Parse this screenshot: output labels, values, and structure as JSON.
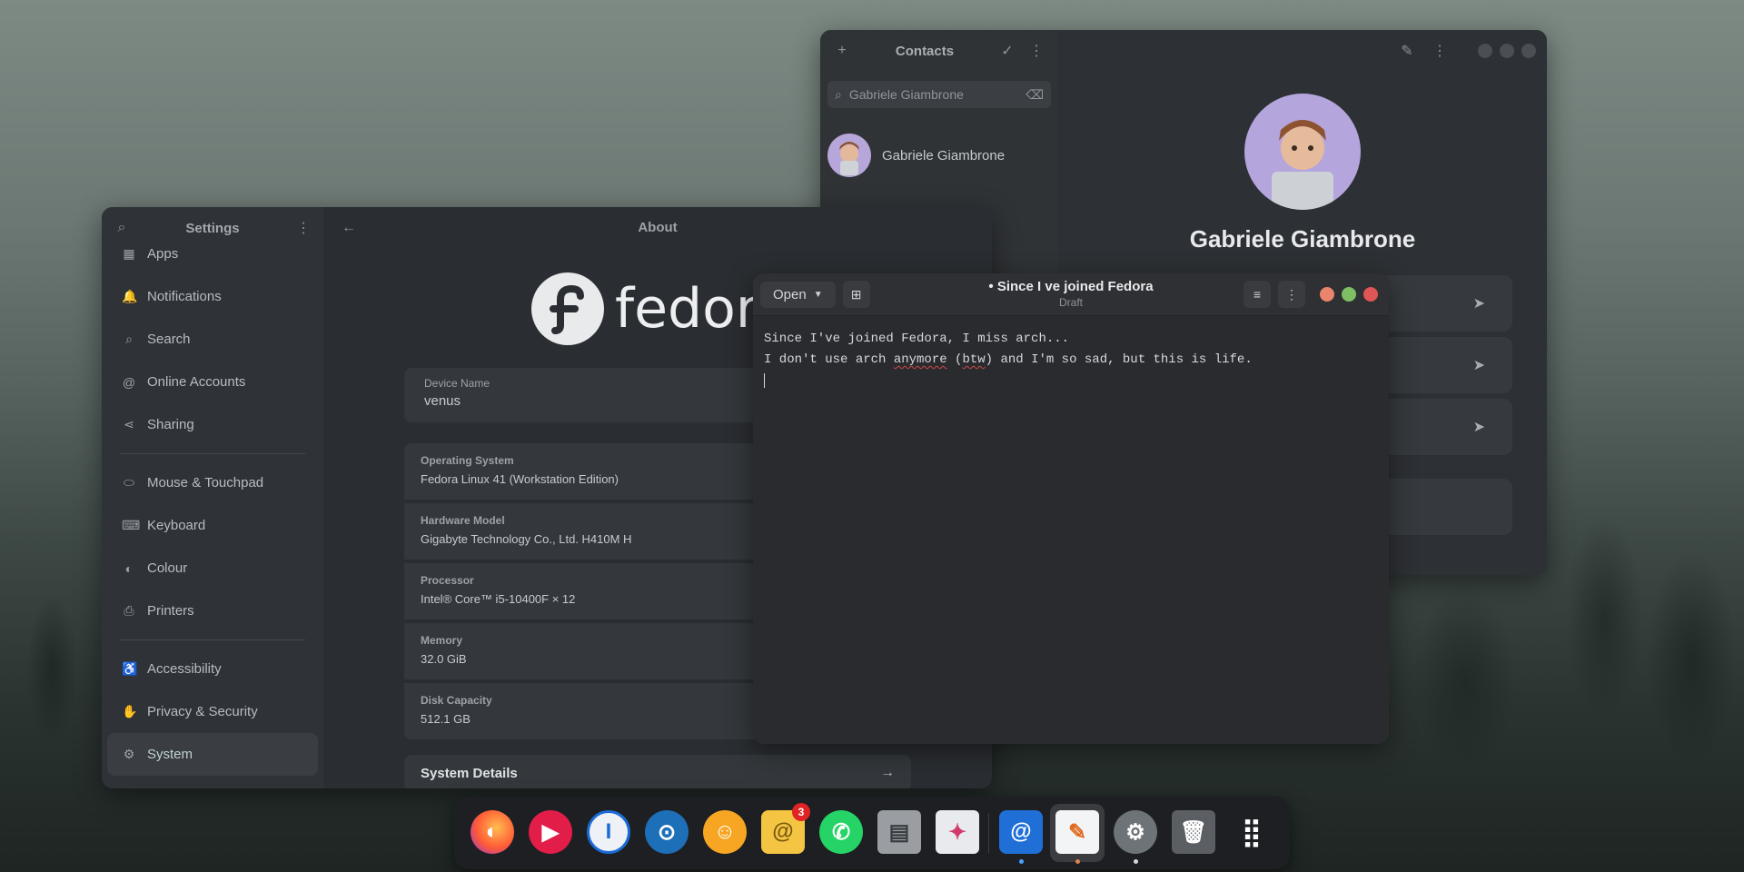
{
  "contacts": {
    "title": "Contacts",
    "search_value": "Gabriele Giambrone",
    "contact_name": "Gabriele Giambrone",
    "detail_name": "Gabriele Giambrone"
  },
  "settings": {
    "title": "Settings",
    "page_title": "About",
    "nav": [
      {
        "label": "Apps",
        "icon": "apps-icon",
        "glyph": "▦"
      },
      {
        "label": "Notifications",
        "icon": "bell-icon",
        "glyph": "🔔"
      },
      {
        "label": "Search",
        "icon": "search-icon",
        "glyph": "⌕"
      },
      {
        "label": "Online Accounts",
        "icon": "at-icon",
        "glyph": "@"
      },
      {
        "label": "Sharing",
        "icon": "share-icon",
        "glyph": "⋖"
      },
      {
        "label": "Mouse & Touchpad",
        "icon": "mouse-icon",
        "glyph": "⬭"
      },
      {
        "label": "Keyboard",
        "icon": "keyboard-icon",
        "glyph": "⌨"
      },
      {
        "label": "Colour",
        "icon": "colour-icon",
        "glyph": "◐"
      },
      {
        "label": "Printers",
        "icon": "printer-icon",
        "glyph": "⎙"
      },
      {
        "label": "Accessibility",
        "icon": "accessibility-icon",
        "glyph": "♿"
      },
      {
        "label": "Privacy & Security",
        "icon": "hand-icon",
        "glyph": "✋"
      },
      {
        "label": "System",
        "icon": "gear-icon",
        "glyph": "⚙"
      }
    ],
    "logo_text": "fedor",
    "device_name_label": "Device Name",
    "device_name_value": "venus",
    "info": [
      {
        "label": "Operating System",
        "value": "Fedora Linux 41 (Workstation Edition)"
      },
      {
        "label": "Hardware Model",
        "value": "Gigabyte Technology Co., Ltd. H410M H"
      },
      {
        "label": "Processor",
        "value": "Intel® Core™ i5-10400F × 12"
      },
      {
        "label": "Memory",
        "value": "32.0 GiB"
      },
      {
        "label": "Disk Capacity",
        "value": "512.1 GB"
      }
    ],
    "system_details": "System Details"
  },
  "editor": {
    "open_label": "Open",
    "title": "Since I ve joined Fedora",
    "subtitle": "Draft",
    "line1": "Since I've joined Fedora, I miss arch...",
    "line2_a": "I don't use arch ",
    "line2_err1": "anymore",
    "line2_b": " (",
    "line2_err2": "btw",
    "line2_c": ") and I'm so sad, but this is life."
  },
  "dock": {
    "badge_count": "3",
    "apps": [
      "firefox-icon",
      "music-icon",
      "password-manager-icon",
      "steam-icon",
      "discord-icon",
      "mail-icon",
      "whatsapp-icon",
      "files-icon",
      "software-icon",
      "mail-client-icon",
      "text-editor-icon",
      "settings-icon",
      "trash-icon",
      "app-grid-icon"
    ]
  }
}
